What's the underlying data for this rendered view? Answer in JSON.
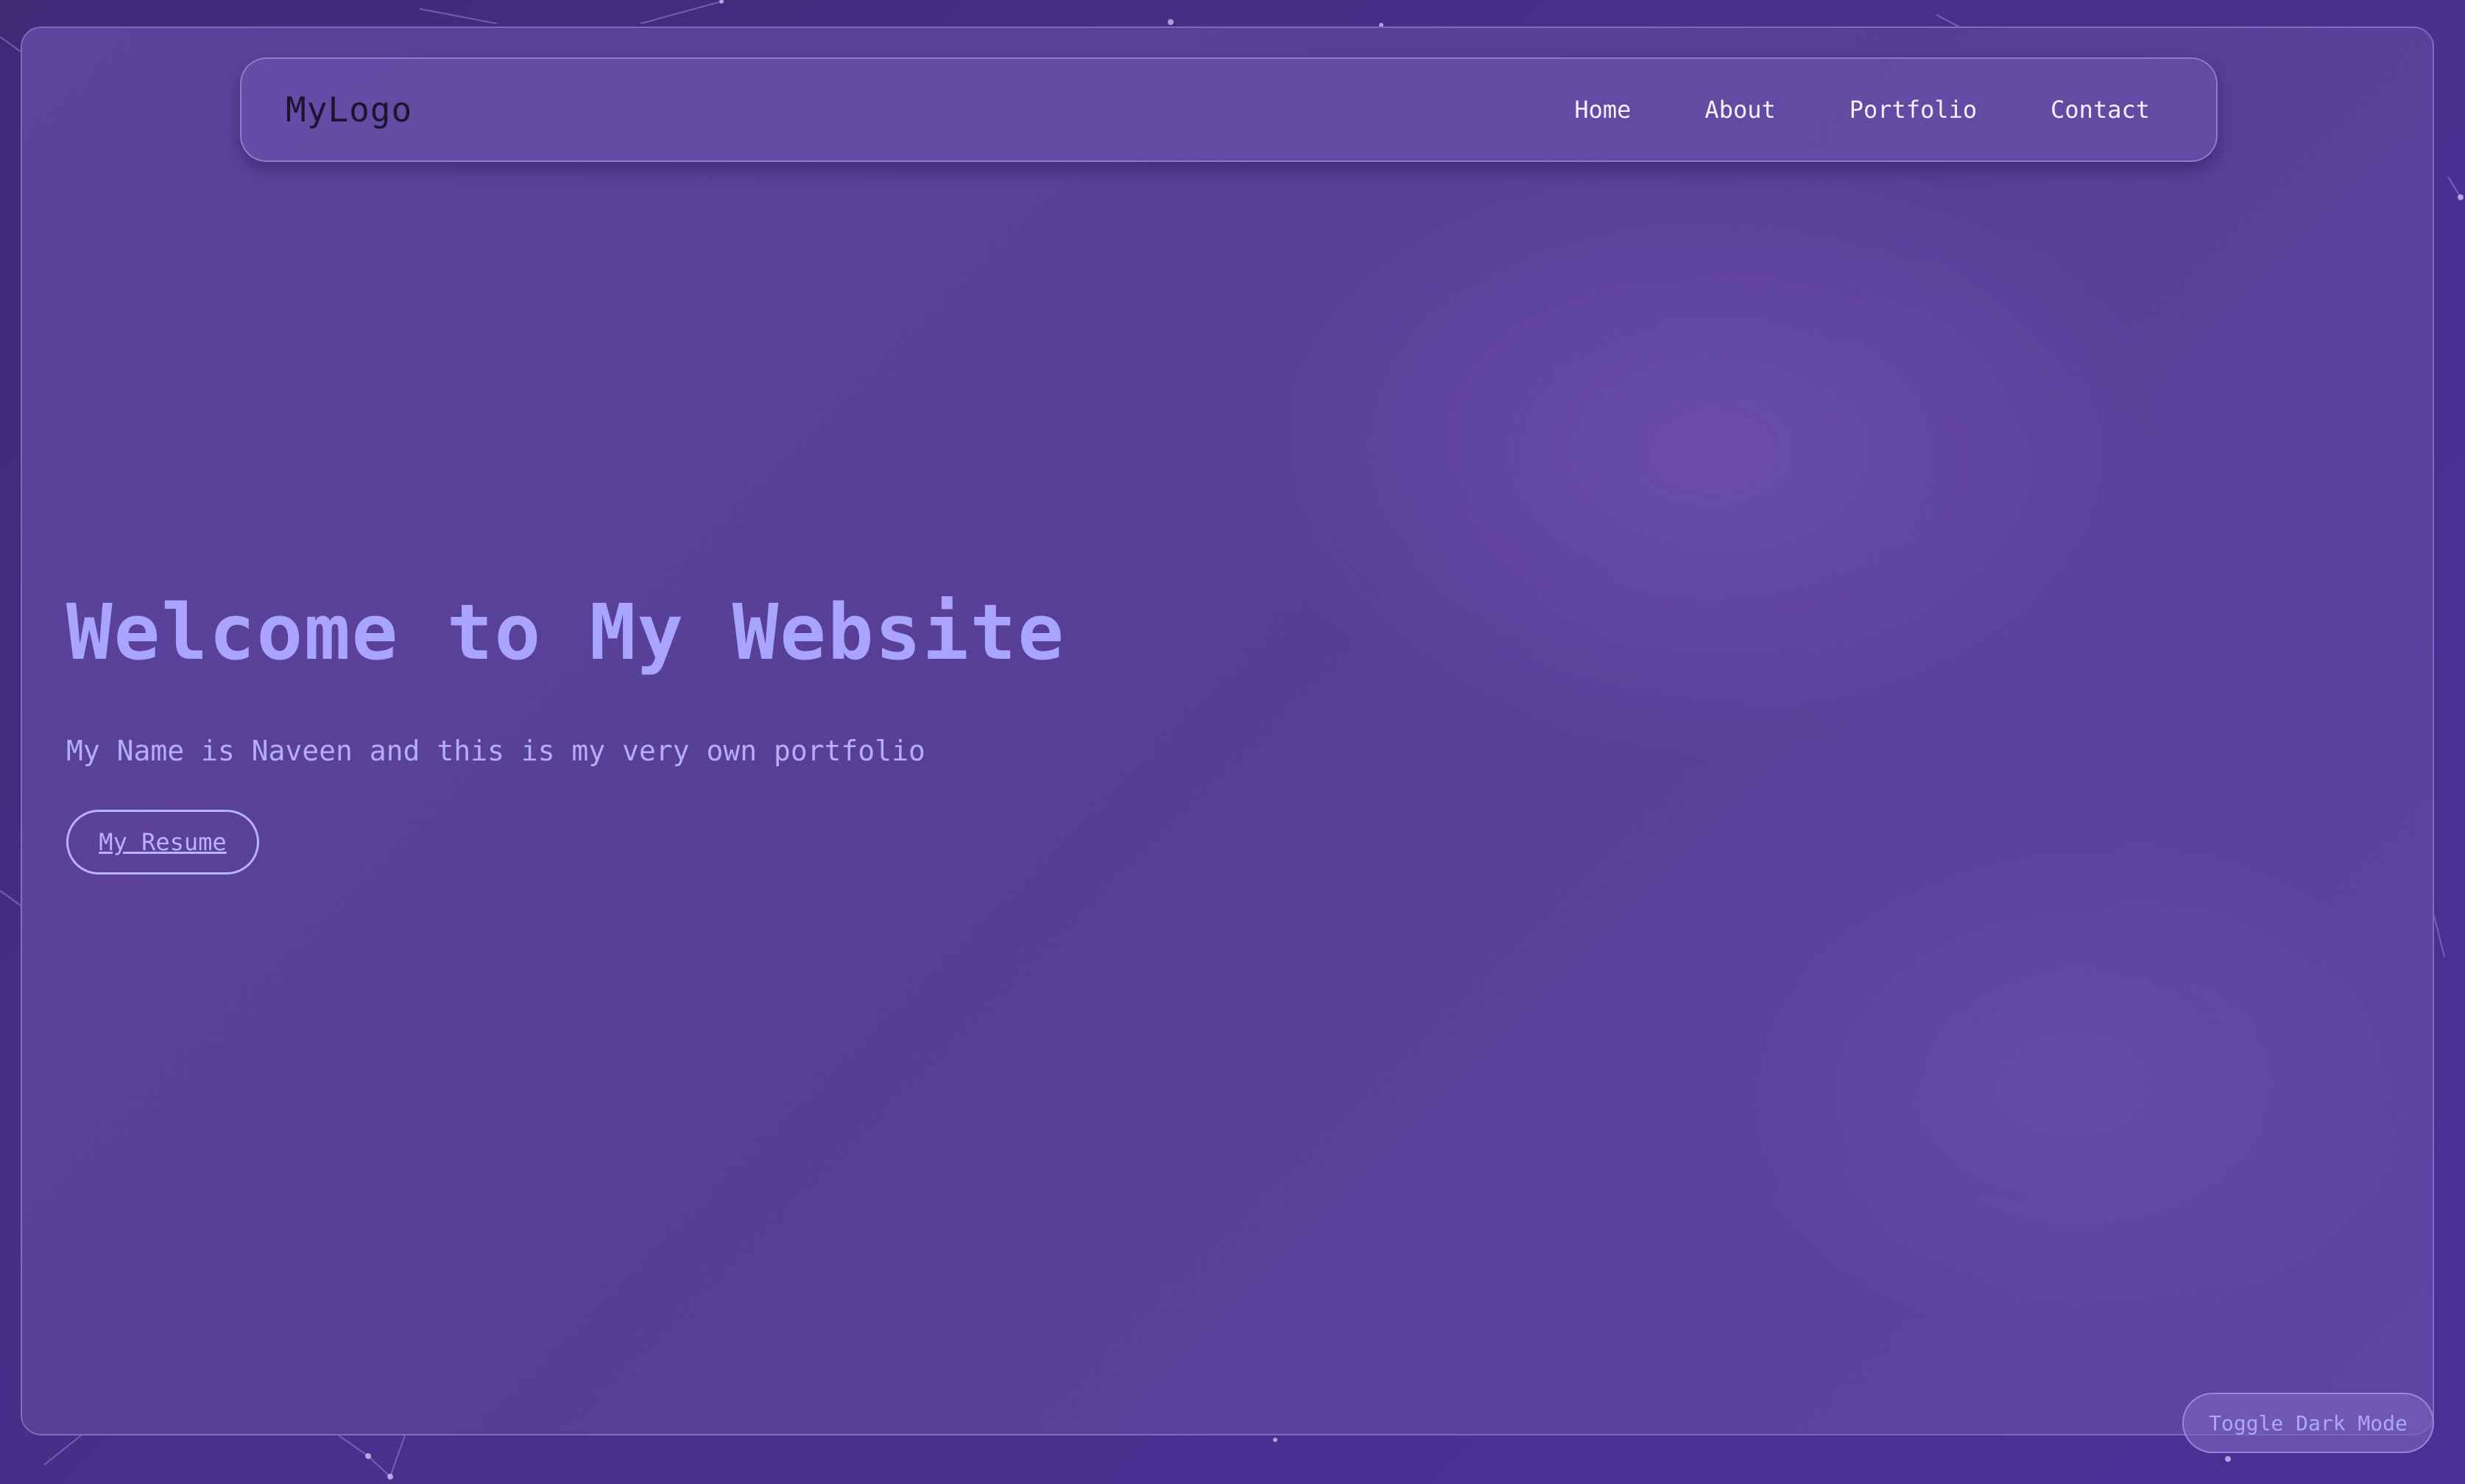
{
  "navbar": {
    "logo": "MyLogo",
    "links": [
      {
        "label": "Home"
      },
      {
        "label": "About"
      },
      {
        "label": "Portfolio"
      },
      {
        "label": "Contact"
      }
    ]
  },
  "hero": {
    "title": "Welcome to My Website",
    "subtitle": "My Name is Naveen and this is my very own portfolio",
    "resume_label": "My Resume"
  },
  "toggle": {
    "label": "Toggle Dark Mode"
  },
  "colors": {
    "background": "#4a2f8c",
    "accent": "#a9a4ff",
    "nav_text": "#f4f0ff",
    "logo_text": "#1c1530"
  }
}
